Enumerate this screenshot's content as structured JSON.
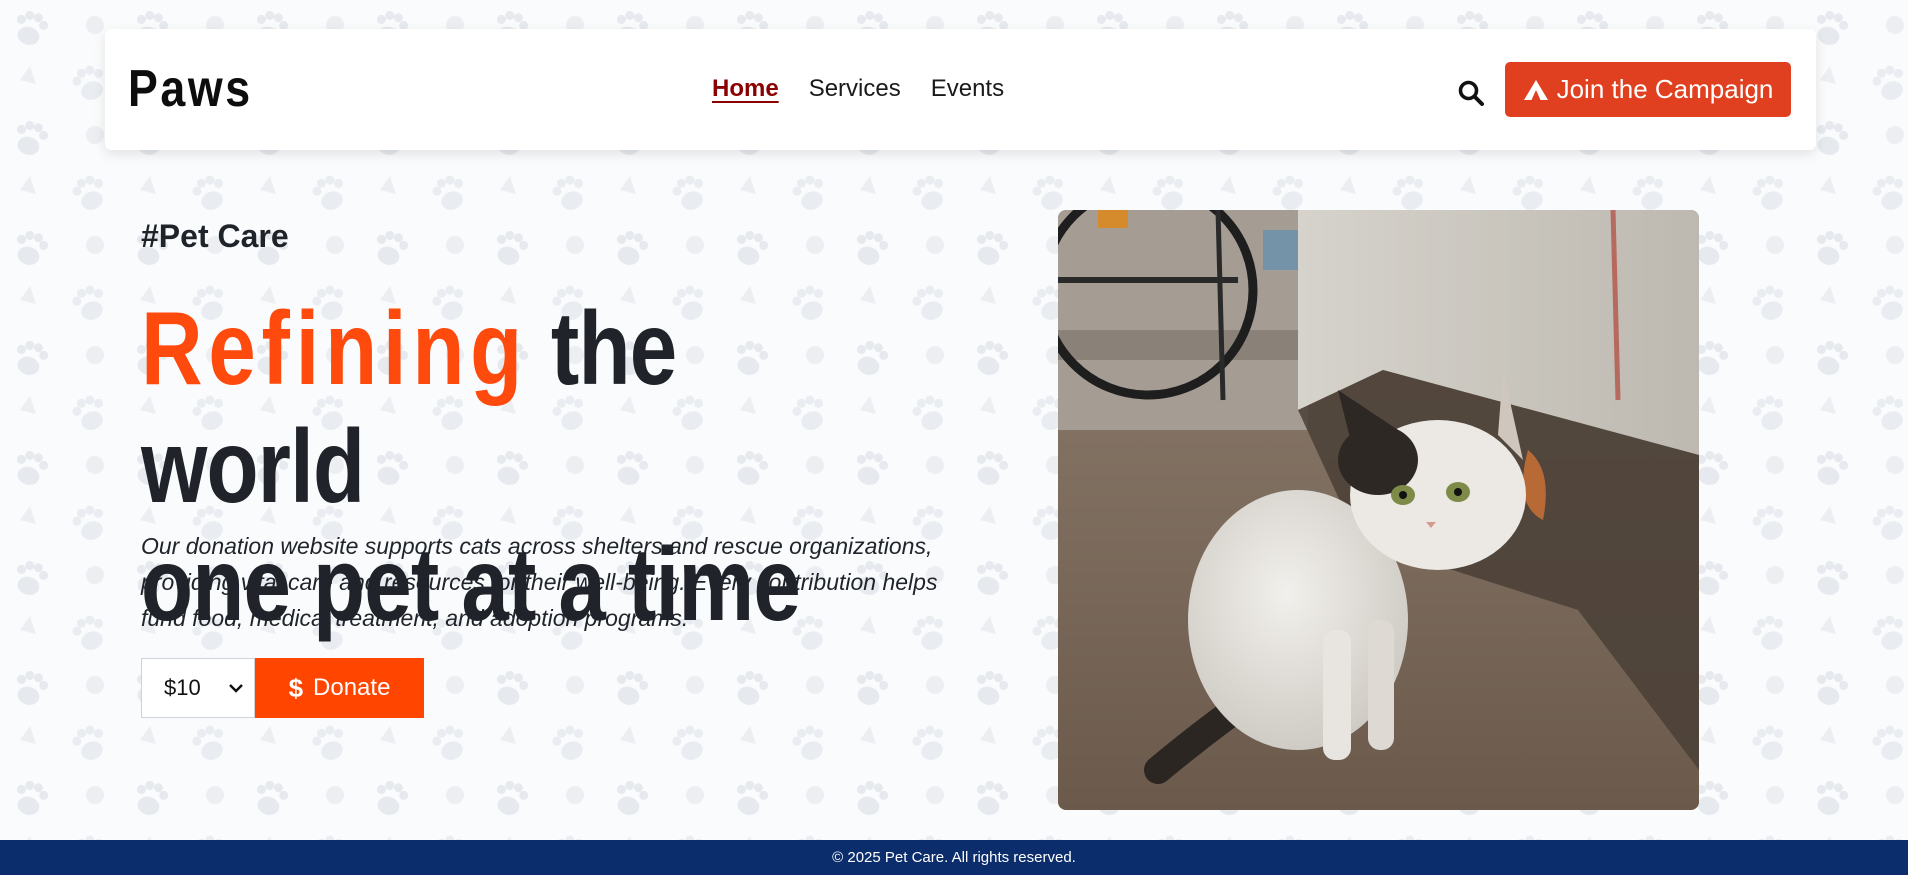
{
  "header": {
    "logo": "Paws",
    "nav": [
      {
        "label": "Home",
        "active": true
      },
      {
        "label": "Services",
        "active": false
      },
      {
        "label": "Events",
        "active": false
      }
    ],
    "search_icon": "search-icon",
    "cta_icon": "campground-icon",
    "cta_label": "Join the Campaign"
  },
  "hero": {
    "tag": "#Pet Care",
    "headline_accent": "Refining",
    "headline_rest_line1": "the world",
    "headline_line2": "one pet at a time",
    "description": "Our donation website supports cats across shelters and rescue organizations, providing vital care and resources for their well-being. Every contribution helps fund food, medical treatment, and adoption programs.",
    "donation": {
      "selected_amount": "$10",
      "button_icon": "dollar-icon",
      "button_label": "Donate"
    }
  },
  "image": {
    "subject": "white kitten sitting beside wall with bicycle in background"
  },
  "footer": {
    "text": "© 2025 Pet Care. All rights reserved."
  },
  "colors": {
    "accent": "#ff4500",
    "cta": "#e0401f",
    "active_nav": "#8b0000",
    "footer_bg": "#0b2d6b",
    "text_dark": "#20232a"
  }
}
